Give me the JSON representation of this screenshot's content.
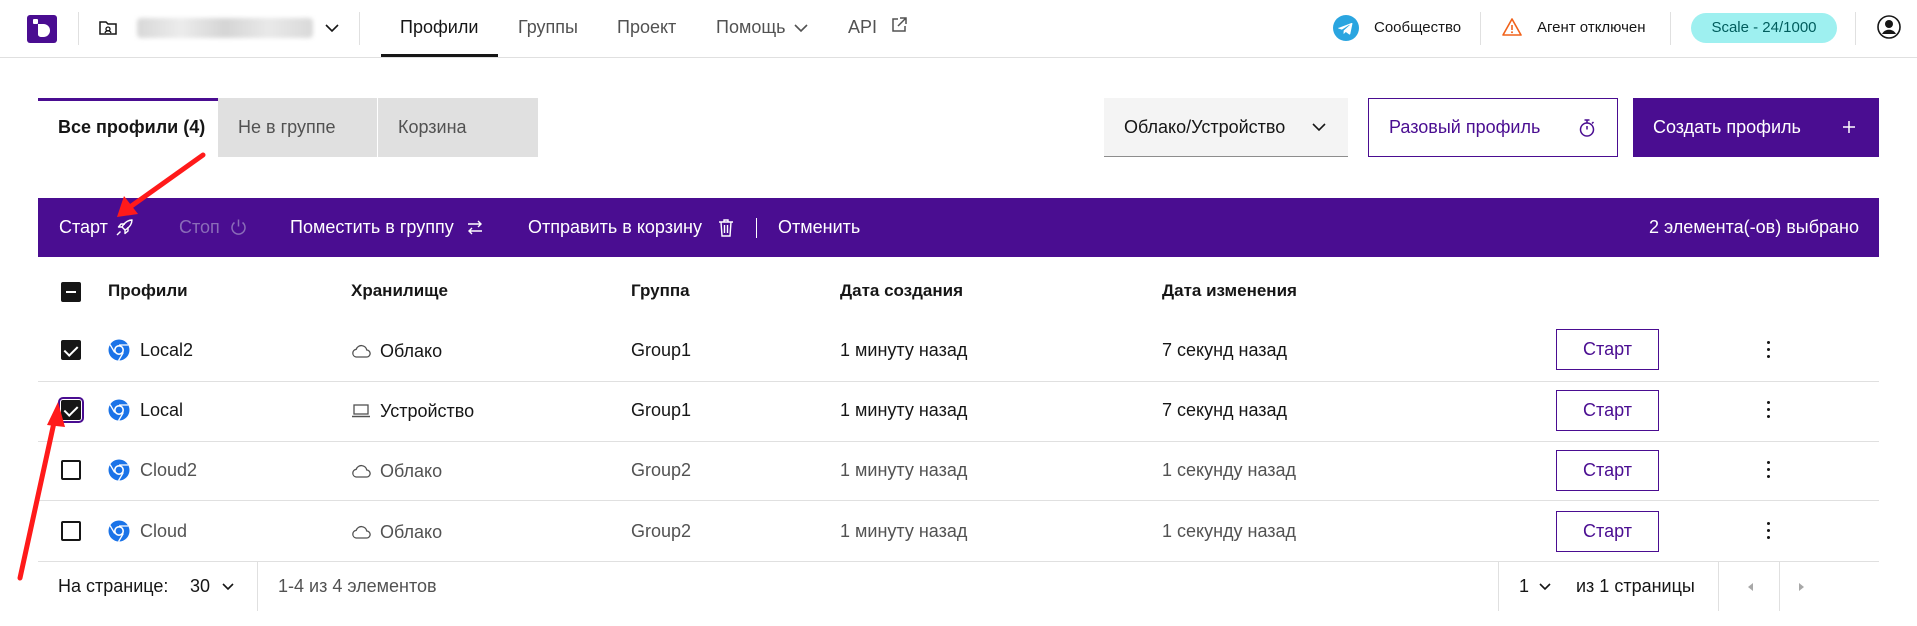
{
  "header": {
    "nav": [
      "Профили",
      "Группы",
      "Проект",
      "Помощь",
      "API"
    ],
    "community": "Сообщество",
    "agent_status": "Агент отключен",
    "plan_badge": "Scale - 24/1000"
  },
  "tabs": [
    "Все профили (4)",
    "Не в группе",
    "Корзина"
  ],
  "toolbar": {
    "storage_filter": "Облако/Устройство",
    "one_time_profile": "Разовый профиль",
    "create_profile": "Создать профиль"
  },
  "action_bar": {
    "start": "Старт",
    "stop": "Стоп",
    "move_to_group": "Поместить в группу",
    "send_to_trash": "Отправить в корзину",
    "cancel": "Отменить",
    "selected_count": "2 элемента(-ов) выбрано"
  },
  "table": {
    "columns": [
      "Профили",
      "Хранилище",
      "Группа",
      "Дата создания",
      "Дата изменения"
    ],
    "rows": [
      {
        "checked": true,
        "name": "Local2",
        "storage": "Облако",
        "storage_icon": "cloud-icon",
        "group": "Group1",
        "created": "1 минуту назад",
        "modified": "7 секунд назад",
        "action": "Старт"
      },
      {
        "checked": true,
        "name": "Local",
        "storage": "Устройство",
        "storage_icon": "laptop-icon",
        "group": "Group1",
        "created": "1 минуту назад",
        "modified": "7 секунд назад",
        "action": "Старт"
      },
      {
        "checked": false,
        "name": "Cloud2",
        "storage": "Облако",
        "storage_icon": "cloud-icon",
        "group": "Group2",
        "created": "1 минуту назад",
        "modified": "1 секунду назад",
        "action": "Старт"
      },
      {
        "checked": false,
        "name": "Cloud",
        "storage": "Облако",
        "storage_icon": "cloud-icon",
        "group": "Group2",
        "created": "1 минуту назад",
        "modified": "1 секунду назад",
        "action": "Старт"
      }
    ]
  },
  "pagination": {
    "per_page_label": "На странице:",
    "per_page": "30",
    "range": "1-4 из 4 элементов",
    "page": "1",
    "of_pages": "из 1 страницы"
  },
  "colors": {
    "accent": "#4a0d91",
    "badge": "#9ef0f0",
    "annotation_arrow": "#ff1a1a"
  }
}
